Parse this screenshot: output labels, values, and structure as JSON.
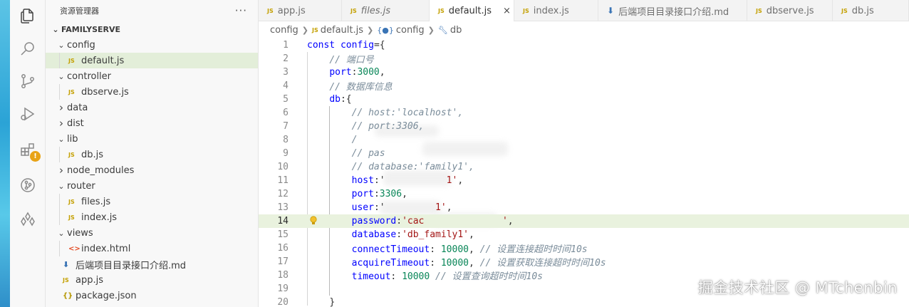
{
  "activity": {
    "items": [
      "explorer",
      "search",
      "source-control",
      "run-debug",
      "extensions",
      "git-graph",
      "remote"
    ]
  },
  "sidebar": {
    "title": "资源管理器",
    "more": "···",
    "section": "FAMILYSERVE",
    "tree": [
      {
        "label": "config",
        "kind": "folder",
        "open": true,
        "depth": 0
      },
      {
        "label": "default.js",
        "kind": "js",
        "depth": 1,
        "selected": true
      },
      {
        "label": "controller",
        "kind": "folder",
        "open": true,
        "depth": 0
      },
      {
        "label": "dbserve.js",
        "kind": "js",
        "depth": 1
      },
      {
        "label": "data",
        "kind": "folder",
        "open": false,
        "depth": 0
      },
      {
        "label": "dist",
        "kind": "folder",
        "open": false,
        "depth": 0
      },
      {
        "label": "lib",
        "kind": "folder",
        "open": true,
        "depth": 0
      },
      {
        "label": "db.js",
        "kind": "js",
        "depth": 1
      },
      {
        "label": "node_modules",
        "kind": "folder",
        "open": false,
        "depth": 0
      },
      {
        "label": "router",
        "kind": "folder",
        "open": true,
        "depth": 0
      },
      {
        "label": "files.js",
        "kind": "js",
        "depth": 1
      },
      {
        "label": "index.js",
        "kind": "js",
        "depth": 1
      },
      {
        "label": "views",
        "kind": "folder",
        "open": true,
        "depth": 0
      },
      {
        "label": "index.html",
        "kind": "html",
        "depth": 1
      },
      {
        "label": "后端项目目录接口介绍.md",
        "kind": "md",
        "depth": 0
      },
      {
        "label": "app.js",
        "kind": "js",
        "depth": 0
      },
      {
        "label": "package.json",
        "kind": "json",
        "depth": 0
      }
    ]
  },
  "tabs": [
    {
      "label": "app.js",
      "icon": "JS",
      "active": false,
      "italic": false
    },
    {
      "label": "files.js",
      "icon": "JS",
      "active": false,
      "italic": true
    },
    {
      "label": "default.js",
      "icon": "JS",
      "active": true,
      "italic": false,
      "close": "×"
    },
    {
      "label": "index.js",
      "icon": "JS",
      "active": false,
      "italic": false
    },
    {
      "label": "后端项目目录接口介绍.md",
      "icon": "md",
      "active": false,
      "italic": false
    },
    {
      "label": "dbserve.js",
      "icon": "JS",
      "active": false,
      "italic": false
    },
    {
      "label": "db.js",
      "icon": "JS",
      "active": false,
      "italic": false
    }
  ],
  "breadcrumb": {
    "folder": "config",
    "file": "default.js",
    "obj": "config",
    "prop": "db",
    "js_icon": "JS",
    "obj_icon": "{●}"
  },
  "editor": {
    "highlighted_line": 14,
    "lines": [
      {
        "n": "1",
        "tokens": [
          [
            "kw",
            "const "
          ],
          [
            "prop",
            "config"
          ],
          [
            "pun",
            "={"
          ]
        ]
      },
      {
        "n": "2",
        "tokens": [
          [
            "ws",
            "    "
          ],
          [
            "cm",
            "// 端口号"
          ]
        ]
      },
      {
        "n": "3",
        "tokens": [
          [
            "ws",
            "    "
          ],
          [
            "prop",
            "port"
          ],
          [
            "pun",
            ":"
          ],
          [
            "num",
            "3000"
          ],
          [
            "pun",
            ","
          ]
        ]
      },
      {
        "n": "4",
        "tokens": [
          [
            "ws",
            "    "
          ],
          [
            "cm",
            "// 数据库信息"
          ]
        ]
      },
      {
        "n": "5",
        "tokens": [
          [
            "ws",
            "    "
          ],
          [
            "prop",
            "db"
          ],
          [
            "pun",
            ":{"
          ]
        ]
      },
      {
        "n": "6",
        "tokens": [
          [
            "ws",
            "        "
          ],
          [
            "cm",
            "// host:'localhost',"
          ]
        ]
      },
      {
        "n": "7",
        "tokens": [
          [
            "ws",
            "        "
          ],
          [
            "cm",
            "// port:3306,"
          ]
        ]
      },
      {
        "n": "8",
        "tokens": [
          [
            "ws",
            "        "
          ],
          [
            "cm",
            "/"
          ]
        ]
      },
      {
        "n": "9",
        "tokens": [
          [
            "ws",
            "        "
          ],
          [
            "cm",
            "// pas"
          ]
        ]
      },
      {
        "n": "10",
        "tokens": [
          [
            "ws",
            "        "
          ],
          [
            "cm",
            "// database:'family1',"
          ]
        ]
      },
      {
        "n": "11",
        "tokens": [
          [
            "ws",
            "        "
          ],
          [
            "prop",
            "host"
          ],
          [
            "pun",
            ":'"
          ],
          [
            "str",
            "           1'"
          ],
          [
            "pun",
            ","
          ]
        ]
      },
      {
        "n": "12",
        "tokens": [
          [
            "ws",
            "        "
          ],
          [
            "prop",
            "port"
          ],
          [
            "pun",
            ":"
          ],
          [
            "num",
            "3306"
          ],
          [
            "pun",
            ","
          ]
        ]
      },
      {
        "n": "13",
        "tokens": [
          [
            "ws",
            "        "
          ],
          [
            "prop",
            "user"
          ],
          [
            "pun",
            ":'"
          ],
          [
            "str",
            "         1'"
          ],
          [
            "pun",
            ","
          ]
        ]
      },
      {
        "n": "14",
        "tokens": [
          [
            "ws",
            "        "
          ],
          [
            "prop",
            "password"
          ],
          [
            "pun",
            ":"
          ],
          [
            "str",
            "'cac              '"
          ],
          [
            "pun",
            ","
          ]
        ]
      },
      {
        "n": "15",
        "tokens": [
          [
            "ws",
            "        "
          ],
          [
            "prop",
            "database"
          ],
          [
            "pun",
            ":"
          ],
          [
            "str",
            "'db_family1'"
          ],
          [
            "pun",
            ","
          ]
        ]
      },
      {
        "n": "16",
        "tokens": [
          [
            "ws",
            "        "
          ],
          [
            "prop",
            "connectTimeout"
          ],
          [
            "pun",
            ": "
          ],
          [
            "num",
            "10000"
          ],
          [
            "pun",
            ", "
          ],
          [
            "cm",
            "// 设置连接超时时间10s"
          ]
        ]
      },
      {
        "n": "17",
        "tokens": [
          [
            "ws",
            "        "
          ],
          [
            "prop",
            "acquireTimeout"
          ],
          [
            "pun",
            ": "
          ],
          [
            "num",
            "10000"
          ],
          [
            "pun",
            ", "
          ],
          [
            "cm",
            "// 设置获取连接超时时间10s"
          ]
        ]
      },
      {
        "n": "18",
        "tokens": [
          [
            "ws",
            "        "
          ],
          [
            "prop",
            "timeout"
          ],
          [
            "pun",
            ": "
          ],
          [
            "num",
            "10000"
          ],
          [
            "pun",
            " "
          ],
          [
            "cm",
            "// 设置查询超时时间10s"
          ]
        ]
      },
      {
        "n": "19",
        "tokens": []
      },
      {
        "n": "20",
        "tokens": [
          [
            "ws",
            "    "
          ],
          [
            "pun",
            "}"
          ]
        ]
      }
    ]
  },
  "watermark": "掘金技术社区 @ MTchenbin",
  "colors": {
    "accent": "#005fb8",
    "highlight": "#e9f2de",
    "selected": "#e3eed9",
    "warning": "#e8a317"
  }
}
